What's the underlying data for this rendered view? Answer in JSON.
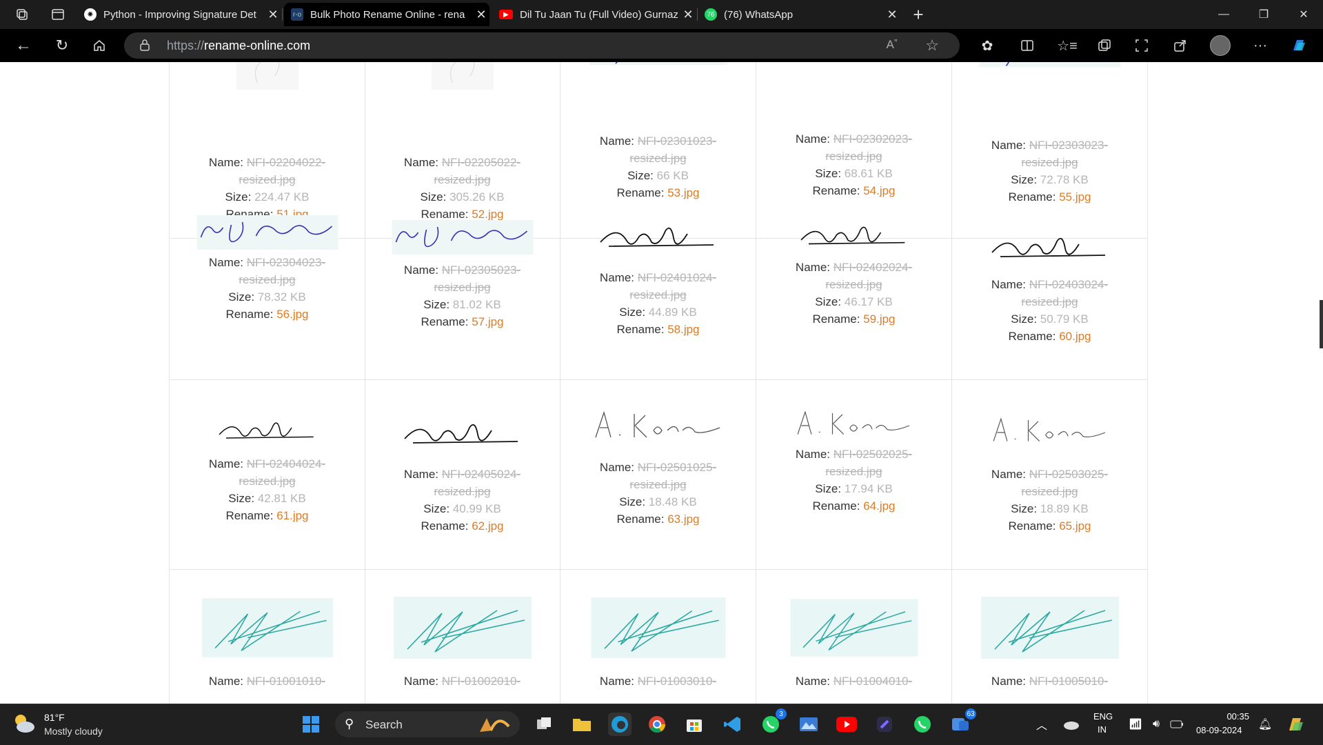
{
  "browser": {
    "tabs": [
      {
        "title": "Python - Improving Signature Det",
        "icon": "chatgpt-icon"
      },
      {
        "title": "Bulk Photo Rename Online - rena",
        "icon": "rename-online-icon"
      },
      {
        "title": "Dil Tu Jaan Tu (Full Video) Gurnaz",
        "icon": "youtube-icon"
      },
      {
        "title": "(76) WhatsApp",
        "icon": "whatsapp-icon"
      }
    ],
    "url_prefix": "https://",
    "url_host": "rename-online.com"
  },
  "labels": {
    "name": "Name: ",
    "size": "Size: ",
    "rename": "Rename: "
  },
  "files": [
    {
      "name1": "NFI-02204022-",
      "name2": "resized.jpg",
      "size": "224.47 KB",
      "rename": "51.jpg"
    },
    {
      "name1": "NFI-02205022-",
      "name2": "resized.jpg",
      "size": "305.26 KB",
      "rename": "52.jpg"
    },
    {
      "name1": "NFI-02301023-",
      "name2": "resized.jpg",
      "size": "66 KB",
      "rename": "53.jpg"
    },
    {
      "name1": "NFI-02302023-",
      "name2": "resized.jpg",
      "size": "68.61 KB",
      "rename": "54.jpg"
    },
    {
      "name1": "NFI-02303023-",
      "name2": "resized.jpg",
      "size": "72.78 KB",
      "rename": "55.jpg"
    },
    {
      "name1": "NFI-02304023-",
      "name2": "resized.jpg",
      "size": "78.32 KB",
      "rename": "56.jpg"
    },
    {
      "name1": "NFI-02305023-",
      "name2": "resized.jpg",
      "size": "81.02 KB",
      "rename": "57.jpg"
    },
    {
      "name1": "NFI-02401024-",
      "name2": "resized.jpg",
      "size": "44.89 KB",
      "rename": "58.jpg"
    },
    {
      "name1": "NFI-02402024-",
      "name2": "resized.jpg",
      "size": "46.17 KB",
      "rename": "59.jpg"
    },
    {
      "name1": "NFI-02403024-",
      "name2": "resized.jpg",
      "size": "50.79 KB",
      "rename": "60.jpg"
    },
    {
      "name1": "NFI-02404024-",
      "name2": "resized.jpg",
      "size": "42.81 KB",
      "rename": "61.jpg"
    },
    {
      "name1": "NFI-02405024-",
      "name2": "resized.jpg",
      "size": "40.99 KB",
      "rename": "62.jpg"
    },
    {
      "name1": "NFI-02501025-",
      "name2": "resized.jpg",
      "size": "18.48 KB",
      "rename": "63.jpg"
    },
    {
      "name1": "NFI-02502025-",
      "name2": "resized.jpg",
      "size": "17.94 KB",
      "rename": "64.jpg"
    },
    {
      "name1": "NFI-02503025-",
      "name2": "resized.jpg",
      "size": "18.89 KB",
      "rename": "65.jpg"
    },
    {
      "name1": "NFI-01001010-"
    },
    {
      "name1": "NFI-01002010-"
    },
    {
      "name1": "NFI-01003010-"
    },
    {
      "name1": "NFI-01004010-"
    },
    {
      "name1": "NFI-01005010-"
    }
  ],
  "taskbar": {
    "weather_temp": "81°F",
    "weather_desc": "Mostly cloudy",
    "search_label": "Search",
    "whatsapp_badge": "3",
    "store_badge": "63",
    "lang1": "ENG",
    "lang2": "IN",
    "time": "00:35",
    "date": "08-09-2024"
  },
  "colors": {
    "rename": "#e07b22",
    "muted": "#b5b5b5",
    "accent": "#1a73e8"
  }
}
